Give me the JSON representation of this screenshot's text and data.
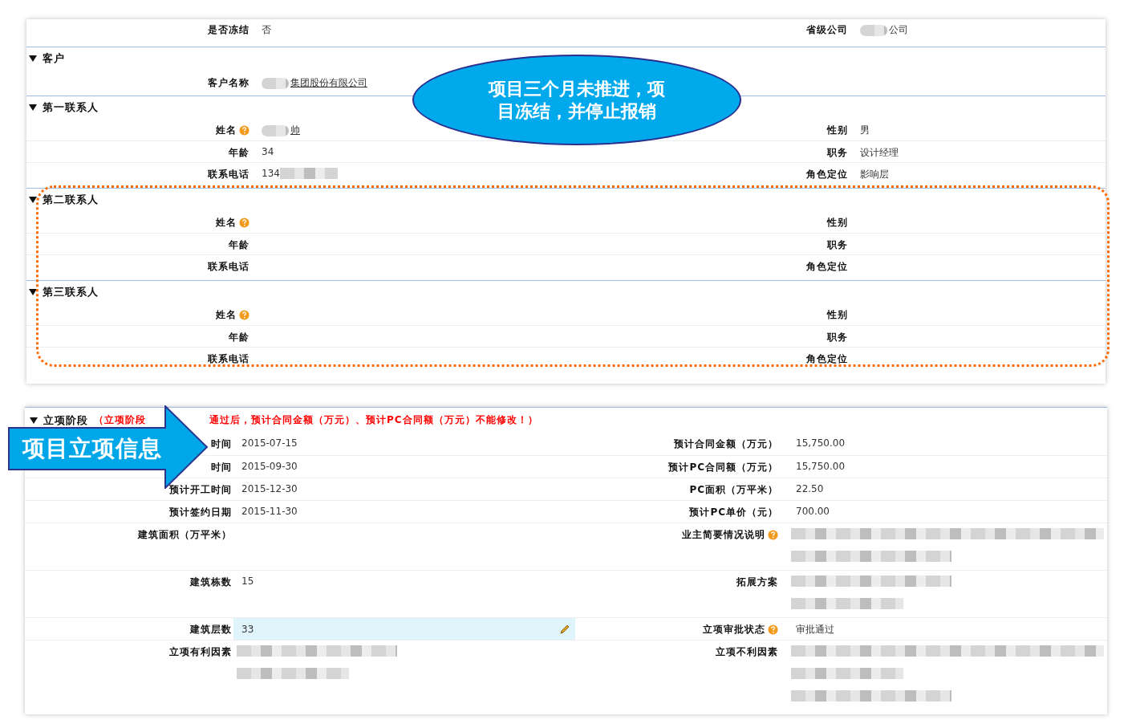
{
  "record_panel": {
    "top_row": {
      "left": {
        "label": "是否冻结",
        "value": "否"
      },
      "right": {
        "label": "省级公司",
        "value": "公司",
        "prefix_redacted": true
      }
    },
    "sections": [
      {
        "title": "客户",
        "expanded": true,
        "rows": [
          {
            "left": {
              "label": "客户名称",
              "value": "集团股份有限公司",
              "prefix_redacted": true,
              "link": true
            },
            "right": {}
          }
        ]
      },
      {
        "title": "第一联系人",
        "expanded": true,
        "rows": [
          {
            "left": {
              "label": "姓名",
              "help": true,
              "value": "帅",
              "prefix_redacted": true,
              "link": true
            },
            "right": {
              "label": "性别",
              "value": "男"
            }
          },
          {
            "left": {
              "label": "年龄",
              "value": "34"
            },
            "right": {
              "label": "职务",
              "value": "设计经理"
            }
          },
          {
            "left": {
              "label": "联系电话",
              "value": "134",
              "suffix_redacted": true
            },
            "right": {
              "label": "角色定位",
              "value": "影响层"
            }
          }
        ]
      },
      {
        "title": "第二联系人",
        "expanded": true,
        "rows": [
          {
            "left": {
              "label": "姓名",
              "help": true
            },
            "right": {
              "label": "性别"
            }
          },
          {
            "left": {
              "label": "年龄"
            },
            "right": {
              "label": "职务"
            }
          },
          {
            "left": {
              "label": "联系电话"
            },
            "right": {
              "label": "角色定位"
            }
          }
        ]
      },
      {
        "title": "第三联系人",
        "expanded": true,
        "rows": [
          {
            "left": {
              "label": "姓名",
              "help": true
            },
            "right": {
              "label": "性别"
            }
          },
          {
            "left": {
              "label": "年龄"
            },
            "right": {
              "label": "职务"
            }
          },
          {
            "left": {
              "label": "联系电话"
            },
            "right": {
              "label": "角色定位"
            }
          }
        ]
      }
    ]
  },
  "project_panel": {
    "title": "立项阶段",
    "expanded": true,
    "note_parts": [
      "（立项阶段",
      "通过后，预计合同金额（万元）、预计PC合同额（万元）不能修改！）"
    ],
    "rows": [
      {
        "left": {
          "label": "时间",
          "value": "2015-07-15"
        },
        "right": {
          "label": "预计合同金额（万元）",
          "value": "15,750.00"
        }
      },
      {
        "left": {
          "label": "时间",
          "value": "2015-09-30"
        },
        "right": {
          "label": "预计PC合同额（万元）",
          "value": "15,750.00"
        }
      },
      {
        "left": {
          "label": "预计开工时间",
          "value": "2015-12-30"
        },
        "right": {
          "label": "PC面积（万平米）",
          "value": "22.50"
        }
      },
      {
        "left": {
          "label": "预计签约日期",
          "value": "2015-11-30"
        },
        "right": {
          "label": "预计PC单价（元）",
          "value": "700.00"
        }
      },
      {
        "left": {
          "label": "建筑面积（万平米）"
        },
        "right": {
          "label": "业主简要情况说明",
          "help": true,
          "redacted": [
            {
              "kind": "long"
            },
            {
              "kind": "medium"
            }
          ]
        }
      },
      {
        "left": {
          "label": "建筑栋数",
          "value": "15"
        },
        "right": {
          "label": "拓展方案",
          "redacted": [
            {
              "kind": "medium"
            },
            {
              "kind": "short"
            }
          ]
        }
      },
      {
        "left": {
          "label": "建筑层数",
          "value": "33",
          "editable": true
        },
        "right": {
          "label": "立项审批状态",
          "help": true,
          "value": "审批通过"
        }
      },
      {
        "left": {
          "label": "立项有利因素",
          "redacted": [
            {
              "kind": "medium"
            },
            {
              "kind": "short"
            }
          ]
        },
        "right": {
          "label": "立项不利因素",
          "redacted": [
            {
              "kind": "long"
            },
            {
              "kind": "short"
            },
            {
              "kind": "medium"
            }
          ]
        }
      }
    ]
  },
  "callouts": {
    "bubble_lines": [
      "项目三个月未推进，项",
      "目冻结，并停止报销"
    ],
    "arrow_label": "项目立项信息"
  }
}
